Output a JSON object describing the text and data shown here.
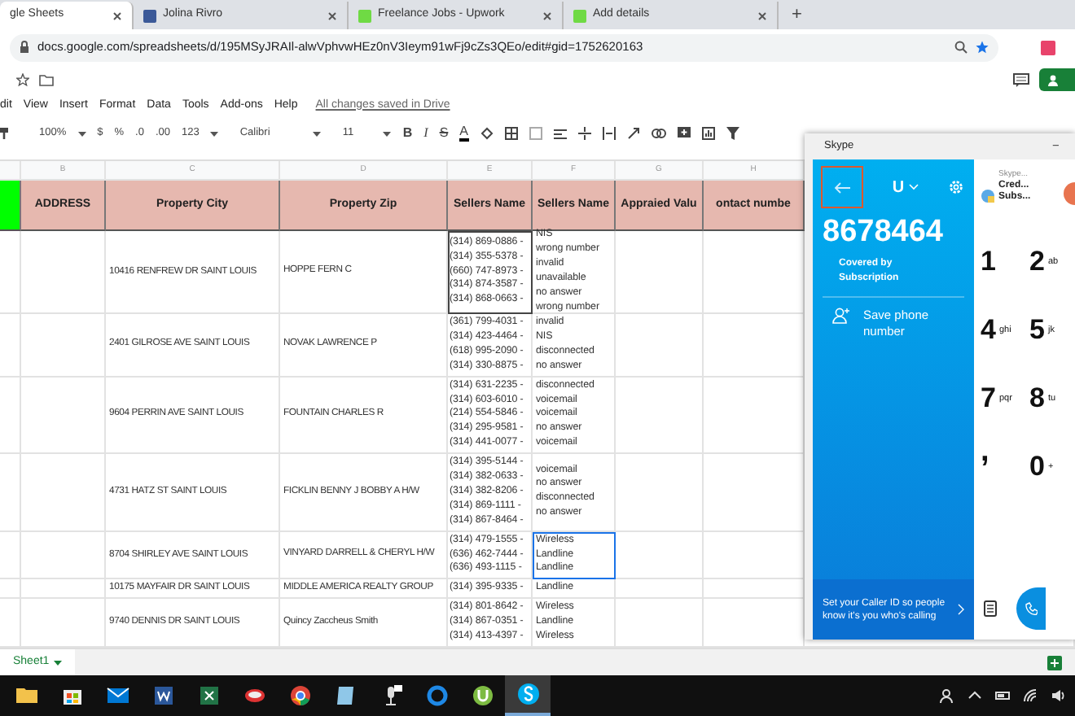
{
  "browser": {
    "tabs": [
      {
        "title": "gle Sheets",
        "kind": "plain",
        "selected": true
      },
      {
        "title": "Jolina Rivro",
        "kind": "square",
        "selected": false
      },
      {
        "title": "Freelance Jobs - Upwork",
        "kind": "tile",
        "selected": false
      },
      {
        "title": "Add details",
        "kind": "tile",
        "selected": false
      }
    ],
    "new_tab": "+",
    "url": "docs.google.com/spreadsheets/d/195MSyJRAIl-alwVphvwHEz0nV3Ieym91wFj9cZs3QEo/edit#gid=1752620163"
  },
  "doc": {
    "menu": [
      "dit",
      "View",
      "Insert",
      "Format",
      "Data",
      "Tools",
      "Add-ons",
      "Help"
    ],
    "save_status": "All changes saved in Drive",
    "toolbar": {
      "zoom": "100%",
      "currency": "$",
      "percent": "%",
      "decimal_less": ".0",
      "decimal_more": ".00",
      "number_format": "123",
      "font": "Calibri",
      "font_size": "11",
      "bold": "B",
      "italic": "I",
      "strike": "S",
      "text_color": "A"
    }
  },
  "sheet": {
    "column_letters": [
      "B",
      "C",
      "D",
      "E",
      "F",
      "G",
      "H"
    ],
    "headers": [
      "ADDRESS",
      "Property City",
      "Property Zip",
      "Sellers Name",
      "Sellers Name",
      "Appraied Valu",
      "ontact numbe"
    ],
    "rows": [
      {
        "col_c": "10416 RENFREW DR SAINT LOUIS",
        "col_d": "HOPPE FERN C",
        "col_e": [
          "(314) 869-0886 -",
          "(314) 355-5378 -",
          "(660) 747-8973 -",
          "(314) 874-3587 -",
          "(314) 868-0663 -"
        ],
        "col_f": [
          "NIS",
          "wrong number",
          "invalid",
          "unavailable",
          "no answer",
          "wrong number"
        ],
        "outlined": true,
        "selected": false
      },
      {
        "col_c": "2401 GILROSE AVE SAINT LOUIS",
        "col_d": "NOVAK LAWRENCE P",
        "col_e": [
          "(361) 799-4031 -",
          "(314) 423-4464 -",
          "(618) 995-2090 -",
          "(314) 330-8875 -"
        ],
        "col_f": [
          "invalid",
          "NIS",
          "disconnected",
          "no answer"
        ],
        "outlined": false,
        "selected": false
      },
      {
        "col_c": "9604 PERRIN AVE SAINT LOUIS",
        "col_d": "FOUNTAIN CHARLES R",
        "col_e": [
          "(314) 631-2235 -",
          "(314) 603-6010 -",
          "(214) 554-5846 -",
          "(314) 295-9581 -",
          "(314) 441-0077 -"
        ],
        "col_f": [
          "disconnected",
          "voicemail",
          "voicemail",
          "no answer",
          "voicemail"
        ],
        "outlined": false,
        "selected": false
      },
      {
        "col_c": "4731 HATZ ST SAINT LOUIS",
        "col_d": "FICKLIN BENNY J  BOBBY A  H/W",
        "col_e": [
          "(314) 395-5144 -",
          "(314) 382-0633 -",
          "(314) 382-8206 -",
          "(314) 869-1111 -",
          "(314) 867-8464 -"
        ],
        "col_f": [
          "voicemail",
          "no answer",
          "disconnected",
          "no answer"
        ],
        "outlined": false,
        "selected": false
      },
      {
        "col_c": "8704 SHIRLEY AVE SAINT LOUIS",
        "col_d": "VINYARD DARRELL & CHERYL H/W",
        "col_e": [
          "(314) 479-1555 -",
          "(636) 462-7444 -",
          "(636) 493-1115 -"
        ],
        "col_f": [
          "Wireless",
          "Landline",
          "Landline"
        ],
        "outlined": false,
        "selected": true
      },
      {
        "col_c": "10175 MAYFAIR DR SAINT LOUIS",
        "col_d": "MIDDLE AMERICA REALTY GROUP",
        "col_e": [
          "(314) 395-9335 -"
        ],
        "col_f": [
          "Landline"
        ],
        "outlined": false,
        "selected": false
      },
      {
        "col_c": "9740 DENNIS DR SAINT LOUIS",
        "col_d": "Quincy Zaccheus Smith",
        "col_e": [
          "(314) 801-8642 -",
          "(314) 867-0351 -",
          "(314) 413-4397 -"
        ],
        "col_f": [
          "Wireless",
          "Landline",
          "Wireless"
        ],
        "outlined": false,
        "selected": false
      }
    ]
  },
  "sheet_tabs": [
    {
      "label": "Sheet1",
      "selected": true
    }
  ],
  "skype": {
    "title": "Skype",
    "minimize": "–",
    "back_highlighted": true,
    "account_initial": "U",
    "number": "8678464",
    "coverage": "Covered by Subscription",
    "save_label": "Save phone number",
    "caller_id_hint": "Set your Caller ID so people know it's you who's calling",
    "credit_caption": "Skype...",
    "credit_lines": [
      "Cred...",
      "Subs..."
    ],
    "keys": [
      {
        "kind": "digit",
        "digit": "1"
      },
      {
        "kind": "digit",
        "digit": "2",
        "letters": "ab"
      },
      {
        "kind": "digit",
        "digit": "4",
        "letters": "ghi"
      },
      {
        "kind": "digit",
        "digit": "5",
        "letters": "jk"
      },
      {
        "kind": "digit",
        "digit": "7",
        "letters": "pqr"
      },
      {
        "kind": "digit",
        "digit": "8",
        "letters": "tu"
      },
      {
        "kind": "symbol",
        "digit": ","
      },
      {
        "kind": "digit",
        "digit": "0",
        "letters": "+"
      }
    ]
  },
  "taskbar": {
    "apps": [
      {
        "kind": "folder",
        "selected": false
      },
      {
        "kind": "bag",
        "selected": false
      },
      {
        "kind": "mail",
        "selected": false
      },
      {
        "kind": "w-tile",
        "selected": false
      },
      {
        "kind": "x-tile",
        "selected": false
      },
      {
        "kind": "tool",
        "selected": false
      },
      {
        "kind": "ball",
        "selected": false
      },
      {
        "kind": "notepad",
        "selected": false
      },
      {
        "kind": "mic",
        "selected": false
      },
      {
        "kind": "ring",
        "selected": false
      },
      {
        "kind": "u-ball",
        "selected": false
      },
      {
        "kind": "s-ball",
        "selected": true
      }
    ],
    "tray": [
      {
        "kind": "people"
      },
      {
        "kind": "chevron"
      },
      {
        "kind": "battery"
      },
      {
        "kind": "wifi"
      },
      {
        "kind": "volume"
      }
    ]
  }
}
